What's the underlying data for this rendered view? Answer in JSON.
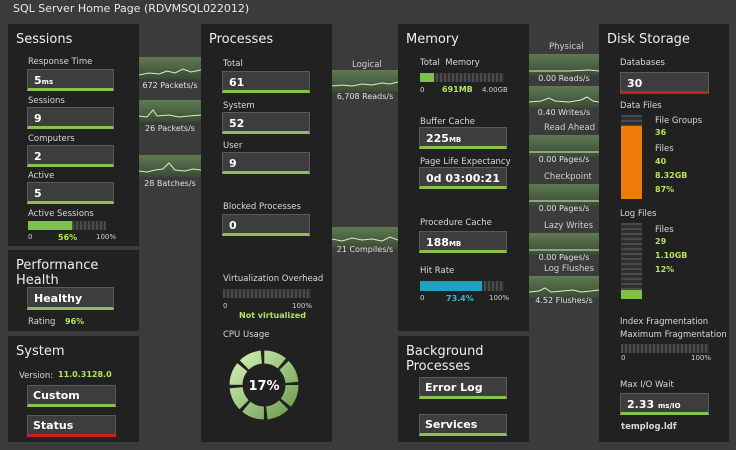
{
  "window_title": "SQL Server Home Page (RDVMSQL022012)",
  "sessions": {
    "title": "Sessions",
    "response_time_label": "Response Time",
    "response_time_value": "5",
    "response_time_unit": "ms",
    "sessions_label": "Sessions",
    "sessions_value": "9",
    "computers_label": "Computers",
    "computers_value": "2",
    "active_label": "Active",
    "active_value": "5",
    "active_sessions_label": "Active Sessions",
    "active_sessions_pct": 56,
    "active_sessions_text": "56%",
    "scale_min": "0",
    "scale_max": "100%"
  },
  "performance_health": {
    "title": "Performance Health",
    "status": "Healthy",
    "rating_label": "Rating",
    "rating_value": "96%"
  },
  "system": {
    "title": "System",
    "version_label": "Version:",
    "version_value": "11.0.3128.0",
    "custom_button": "Custom",
    "status_button": "Status"
  },
  "flows_left": {
    "packets_in": "672 Packets/s",
    "packets_out": "26 Packets/s",
    "batches": "28 Batches/s"
  },
  "processes": {
    "title": "Processes",
    "total_label": "Total",
    "total_value": "61",
    "system_label": "System",
    "system_value": "52",
    "user_label": "User",
    "user_value": "9",
    "blocked_label": "Blocked Processes",
    "blocked_value": "0",
    "virt_label": "Virtualization Overhead",
    "virt_min": "0",
    "virt_max": "100%",
    "virt_status": "Not virtualized",
    "cpu_label": "CPU Usage",
    "cpu_value": "17%",
    "cpu_pct": 17
  },
  "flows_mid": {
    "logical_label": "Logical",
    "logical_rate": "6,708 Reads/s",
    "compiles_rate": "21 Compiles/s"
  },
  "memory": {
    "title": "Memory",
    "total_label": "Total",
    "total_label2": "Memory",
    "mem_min": "0",
    "mem_used": "691MB",
    "mem_max": "4.00GB",
    "mem_pct": 17,
    "buffer_label": "Buffer Cache",
    "buffer_value": "225",
    "buffer_unit": "MB",
    "ple_label": "Page Life Expectancy",
    "ple_value": "0d 03:00:21",
    "proc_label": "Procedure Cache",
    "proc_value": "188",
    "proc_unit": "MB",
    "hit_label": "Hit Rate",
    "hit_min": "0",
    "hit_value": "73.4%",
    "hit_pct": 73.4,
    "hit_max": "100%"
  },
  "background": {
    "title": "Background Processes",
    "error_log": "Error Log",
    "services": "Services"
  },
  "flows_right": {
    "physical_label": "Physical",
    "reads": "0.00 Reads/s",
    "writes": "0.40 Writes/s",
    "readahead_label": "Read Ahead",
    "readahead_rate": "0.00 Pages/s",
    "checkpoint_label": "Checkpoint",
    "checkpoint_rate": "0.00 Pages/s",
    "lazy_label": "Lazy Writes",
    "lazy_rate": "0.00 Pages/s",
    "logflush_label": "Log Flushes",
    "logflush_rate": "4.52 Flushes/s"
  },
  "disk": {
    "title": "Disk Storage",
    "databases_label": "Databases",
    "databases_value": "30",
    "data_files_label": "Data Files",
    "data_fill_pct": 87,
    "fg_label": "File Groups",
    "fg_value": "36",
    "files_label": "Files",
    "files_value": "40",
    "size_value": "8.32GB",
    "pct_value": "87%",
    "log_files_label": "Log Files",
    "log_fill_pct": 12,
    "log_files_sub": "Files",
    "log_files_value": "29",
    "log_size": "1.10GB",
    "log_pct": "12%",
    "frag_label": "Index Fragmentation",
    "maxfrag_label": "Maximum Fragmentation",
    "frag_min": "0",
    "frag_max": "100%",
    "maxio_label": "Max I/O Wait",
    "maxio_value": "2.33",
    "maxio_unit": "ms/IO",
    "maxio_file": "templog.ldf"
  }
}
